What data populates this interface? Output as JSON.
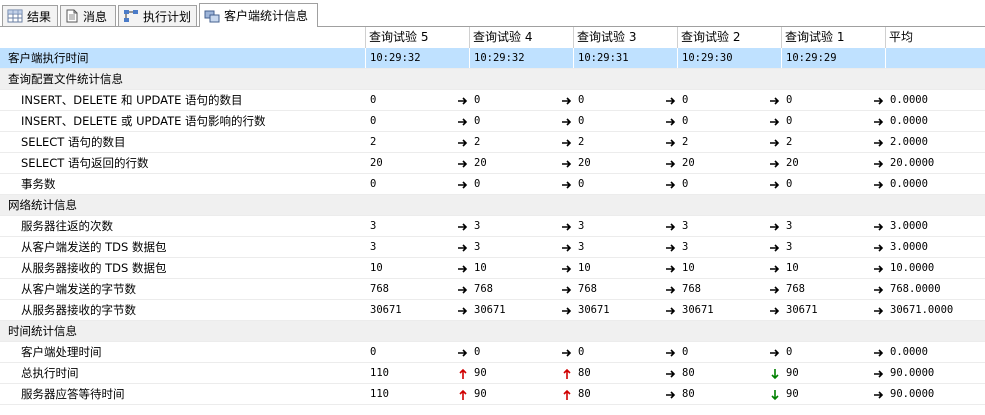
{
  "tabs": [
    {
      "label": "结果",
      "icon": "grid-icon"
    },
    {
      "label": "消息",
      "icon": "document-icon"
    },
    {
      "label": "执行计划",
      "icon": "execution-plan-icon"
    },
    {
      "label": "客户端统计信息",
      "icon": "client-statistics-icon",
      "active": true
    }
  ],
  "columns": [
    "查询试验 5",
    "查询试验 4",
    "查询试验 3",
    "查询试验 2",
    "查询试验 1",
    "平均"
  ],
  "rows": [
    {
      "type": "selected",
      "name": "客户端执行时间",
      "values": [
        "10:29:32",
        "10:29:32",
        "10:29:31",
        "10:29:30",
        "10:29:29",
        ""
      ],
      "arrows": []
    },
    {
      "type": "section",
      "name": "查询配置文件统计信息"
    },
    {
      "type": "data",
      "name": "INSERT、DELETE 和 UPDATE 语句的数目",
      "values": [
        "0",
        "0",
        "0",
        "0",
        "0",
        "0.0000"
      ],
      "arrows": [
        "right",
        "right",
        "right",
        "right",
        "right"
      ]
    },
    {
      "type": "data",
      "name": "INSERT、DELETE 或 UPDATE 语句影响的行数",
      "values": [
        "0",
        "0",
        "0",
        "0",
        "0",
        "0.0000"
      ],
      "arrows": [
        "right",
        "right",
        "right",
        "right",
        "right"
      ]
    },
    {
      "type": "data",
      "name": "SELECT 语句的数目",
      "values": [
        "2",
        "2",
        "2",
        "2",
        "2",
        "2.0000"
      ],
      "arrows": [
        "right",
        "right",
        "right",
        "right",
        "right"
      ]
    },
    {
      "type": "data",
      "name": "SELECT 语句返回的行数",
      "values": [
        "20",
        "20",
        "20",
        "20",
        "20",
        "20.0000"
      ],
      "arrows": [
        "right",
        "right",
        "right",
        "right",
        "right"
      ]
    },
    {
      "type": "data",
      "name": "事务数",
      "values": [
        "0",
        "0",
        "0",
        "0",
        "0",
        "0.0000"
      ],
      "arrows": [
        "right",
        "right",
        "right",
        "right",
        "right"
      ]
    },
    {
      "type": "section",
      "name": "网络统计信息"
    },
    {
      "type": "data",
      "name": "服务器往返的次数",
      "values": [
        "3",
        "3",
        "3",
        "3",
        "3",
        "3.0000"
      ],
      "arrows": [
        "right",
        "right",
        "right",
        "right",
        "right"
      ]
    },
    {
      "type": "data",
      "name": "从客户端发送的 TDS 数据包",
      "values": [
        "3",
        "3",
        "3",
        "3",
        "3",
        "3.0000"
      ],
      "arrows": [
        "right",
        "right",
        "right",
        "right",
        "right"
      ]
    },
    {
      "type": "data",
      "name": "从服务器接收的 TDS 数据包",
      "values": [
        "10",
        "10",
        "10",
        "10",
        "10",
        "10.0000"
      ],
      "arrows": [
        "right",
        "right",
        "right",
        "right",
        "right"
      ]
    },
    {
      "type": "data",
      "name": "从客户端发送的字节数",
      "values": [
        "768",
        "768",
        "768",
        "768",
        "768",
        "768.0000"
      ],
      "arrows": [
        "right",
        "right",
        "right",
        "right",
        "right"
      ]
    },
    {
      "type": "data",
      "name": "从服务器接收的字节数",
      "values": [
        "30671",
        "30671",
        "30671",
        "30671",
        "30671",
        "30671.0000"
      ],
      "arrows": [
        "right",
        "right",
        "right",
        "right",
        "right"
      ]
    },
    {
      "type": "section",
      "name": "时间统计信息"
    },
    {
      "type": "data",
      "name": "客户端处理时间",
      "values": [
        "0",
        "0",
        "0",
        "0",
        "0",
        "0.0000"
      ],
      "arrows": [
        "right",
        "right",
        "right",
        "right",
        "right"
      ]
    },
    {
      "type": "data",
      "name": "总执行时间",
      "values": [
        "110",
        "90",
        "80",
        "80",
        "90",
        "90.0000"
      ],
      "arrows": [
        "up",
        "up",
        "right",
        "down",
        "right"
      ]
    },
    {
      "type": "data",
      "name": "服务器应答等待时间",
      "values": [
        "110",
        "90",
        "80",
        "80",
        "90",
        "90.0000"
      ],
      "arrows": [
        "up",
        "up",
        "right",
        "down",
        "right"
      ]
    }
  ],
  "colors": {
    "selected_row": "#bfe1ff",
    "section_row": "#f0f0f0",
    "arrow_up": "#d00000",
    "arrow_down": "#008000",
    "arrow_right": "#000000"
  }
}
